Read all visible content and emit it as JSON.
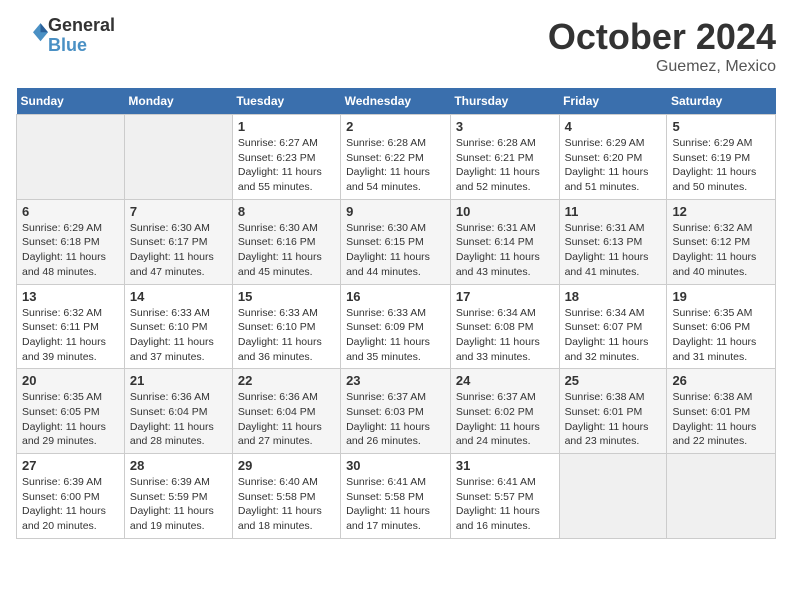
{
  "header": {
    "logo_general": "General",
    "logo_blue": "Blue",
    "month": "October 2024",
    "location": "Guemez, Mexico"
  },
  "days_of_week": [
    "Sunday",
    "Monday",
    "Tuesday",
    "Wednesday",
    "Thursday",
    "Friday",
    "Saturday"
  ],
  "weeks": [
    [
      {
        "day": "",
        "info": ""
      },
      {
        "day": "",
        "info": ""
      },
      {
        "day": "1",
        "info": "Sunrise: 6:27 AM\nSunset: 6:23 PM\nDaylight: 11 hours and 55 minutes."
      },
      {
        "day": "2",
        "info": "Sunrise: 6:28 AM\nSunset: 6:22 PM\nDaylight: 11 hours and 54 minutes."
      },
      {
        "day": "3",
        "info": "Sunrise: 6:28 AM\nSunset: 6:21 PM\nDaylight: 11 hours and 52 minutes."
      },
      {
        "day": "4",
        "info": "Sunrise: 6:29 AM\nSunset: 6:20 PM\nDaylight: 11 hours and 51 minutes."
      },
      {
        "day": "5",
        "info": "Sunrise: 6:29 AM\nSunset: 6:19 PM\nDaylight: 11 hours and 50 minutes."
      }
    ],
    [
      {
        "day": "6",
        "info": "Sunrise: 6:29 AM\nSunset: 6:18 PM\nDaylight: 11 hours and 48 minutes."
      },
      {
        "day": "7",
        "info": "Sunrise: 6:30 AM\nSunset: 6:17 PM\nDaylight: 11 hours and 47 minutes."
      },
      {
        "day": "8",
        "info": "Sunrise: 6:30 AM\nSunset: 6:16 PM\nDaylight: 11 hours and 45 minutes."
      },
      {
        "day": "9",
        "info": "Sunrise: 6:30 AM\nSunset: 6:15 PM\nDaylight: 11 hours and 44 minutes."
      },
      {
        "day": "10",
        "info": "Sunrise: 6:31 AM\nSunset: 6:14 PM\nDaylight: 11 hours and 43 minutes."
      },
      {
        "day": "11",
        "info": "Sunrise: 6:31 AM\nSunset: 6:13 PM\nDaylight: 11 hours and 41 minutes."
      },
      {
        "day": "12",
        "info": "Sunrise: 6:32 AM\nSunset: 6:12 PM\nDaylight: 11 hours and 40 minutes."
      }
    ],
    [
      {
        "day": "13",
        "info": "Sunrise: 6:32 AM\nSunset: 6:11 PM\nDaylight: 11 hours and 39 minutes."
      },
      {
        "day": "14",
        "info": "Sunrise: 6:33 AM\nSunset: 6:10 PM\nDaylight: 11 hours and 37 minutes."
      },
      {
        "day": "15",
        "info": "Sunrise: 6:33 AM\nSunset: 6:10 PM\nDaylight: 11 hours and 36 minutes."
      },
      {
        "day": "16",
        "info": "Sunrise: 6:33 AM\nSunset: 6:09 PM\nDaylight: 11 hours and 35 minutes."
      },
      {
        "day": "17",
        "info": "Sunrise: 6:34 AM\nSunset: 6:08 PM\nDaylight: 11 hours and 33 minutes."
      },
      {
        "day": "18",
        "info": "Sunrise: 6:34 AM\nSunset: 6:07 PM\nDaylight: 11 hours and 32 minutes."
      },
      {
        "day": "19",
        "info": "Sunrise: 6:35 AM\nSunset: 6:06 PM\nDaylight: 11 hours and 31 minutes."
      }
    ],
    [
      {
        "day": "20",
        "info": "Sunrise: 6:35 AM\nSunset: 6:05 PM\nDaylight: 11 hours and 29 minutes."
      },
      {
        "day": "21",
        "info": "Sunrise: 6:36 AM\nSunset: 6:04 PM\nDaylight: 11 hours and 28 minutes."
      },
      {
        "day": "22",
        "info": "Sunrise: 6:36 AM\nSunset: 6:04 PM\nDaylight: 11 hours and 27 minutes."
      },
      {
        "day": "23",
        "info": "Sunrise: 6:37 AM\nSunset: 6:03 PM\nDaylight: 11 hours and 26 minutes."
      },
      {
        "day": "24",
        "info": "Sunrise: 6:37 AM\nSunset: 6:02 PM\nDaylight: 11 hours and 24 minutes."
      },
      {
        "day": "25",
        "info": "Sunrise: 6:38 AM\nSunset: 6:01 PM\nDaylight: 11 hours and 23 minutes."
      },
      {
        "day": "26",
        "info": "Sunrise: 6:38 AM\nSunset: 6:01 PM\nDaylight: 11 hours and 22 minutes."
      }
    ],
    [
      {
        "day": "27",
        "info": "Sunrise: 6:39 AM\nSunset: 6:00 PM\nDaylight: 11 hours and 20 minutes."
      },
      {
        "day": "28",
        "info": "Sunrise: 6:39 AM\nSunset: 5:59 PM\nDaylight: 11 hours and 19 minutes."
      },
      {
        "day": "29",
        "info": "Sunrise: 6:40 AM\nSunset: 5:58 PM\nDaylight: 11 hours and 18 minutes."
      },
      {
        "day": "30",
        "info": "Sunrise: 6:41 AM\nSunset: 5:58 PM\nDaylight: 11 hours and 17 minutes."
      },
      {
        "day": "31",
        "info": "Sunrise: 6:41 AM\nSunset: 5:57 PM\nDaylight: 11 hours and 16 minutes."
      },
      {
        "day": "",
        "info": ""
      },
      {
        "day": "",
        "info": ""
      }
    ]
  ]
}
